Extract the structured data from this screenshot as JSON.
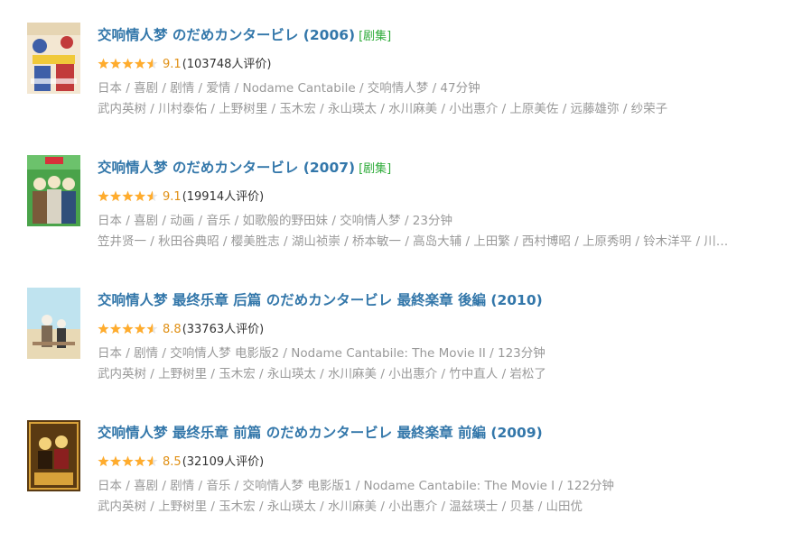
{
  "results": [
    {
      "title": "交响情人梦 のだめカンタービレ (2006)",
      "tag": "[剧集]",
      "score": "9.1",
      "votes": "(103748人评价)",
      "stars": 4.5,
      "meta": "日本 / 喜剧 / 剧情 / 爱情 / Nodame Cantabile / 交响情人梦 / 47分钟",
      "cast": "武内英树 / 川村泰佑 / 上野树里 / 玉木宏 / 永山瑛太 / 水川麻美 / 小出惠介 / 上原美佐 / 远藤雄弥 / 纱荣子",
      "poster_colors": [
        "#f3e7d2",
        "#c23b3b",
        "#3e5fa8",
        "#f0c93a"
      ]
    },
    {
      "title": "交响情人梦 のだめカンタービレ (2007)",
      "tag": "[剧集]",
      "score": "9.1",
      "votes": "(19914人评价)",
      "stars": 4.5,
      "meta": "日本 / 喜剧 / 动画 / 音乐 / 如歌般的野田妹 / 交响情人梦 / 23分钟",
      "cast": "笠井贤一 / 秋田谷典昭 / 樱美胜志 / 湖山祯崇 / 桥本敏一 / 高岛大辅 / 上田繁 / 西村博昭 / 上原秀明 / 铃木洋平 / 川…",
      "poster_colors": [
        "#4aa34a",
        "#f2e6c8",
        "#7a5a3a",
        "#d9d3c4"
      ]
    },
    {
      "title": "交响情人梦 最终乐章 后篇 のだめカンタービレ 最終楽章 後編 (2010)",
      "tag": "",
      "score": "8.8",
      "votes": "(33763人评价)",
      "stars": 4.5,
      "meta": "日本 / 剧情 / 交响情人梦 电影版2 / Nodame Cantabile: The Movie II / 123分钟",
      "cast": "武内英树 / 上野树里 / 玉木宏 / 永山瑛太 / 水川麻美 / 小出惠介 / 竹中直人 / 岩松了",
      "poster_colors": [
        "#bfe3ef",
        "#f5f0e6",
        "#7d6a55",
        "#e8d9b5"
      ]
    },
    {
      "title": "交响情人梦 最终乐章 前篇 のだめカンタービレ 最終楽章 前編 (2009)",
      "tag": "",
      "score": "8.5",
      "votes": "(32109人评价)",
      "stars": 4.5,
      "meta": "日本 / 喜剧 / 剧情 / 音乐 / 交响情人梦 电影版1 / Nodame Cantabile: The Movie I / 122分钟",
      "cast": "武内英树 / 上野树里 / 玉木宏 / 永山瑛太 / 水川麻美 / 小出惠介 / 温兹瑛士 / 贝基 / 山田优",
      "poster_colors": [
        "#5a3a12",
        "#d8a23a",
        "#2b1a0a",
        "#f3d27a"
      ]
    }
  ],
  "colors": {
    "title": "#3377aa",
    "tag": "#2eab3a",
    "score": "#e09015",
    "star": "#ffac2d",
    "meta": "#999999"
  }
}
